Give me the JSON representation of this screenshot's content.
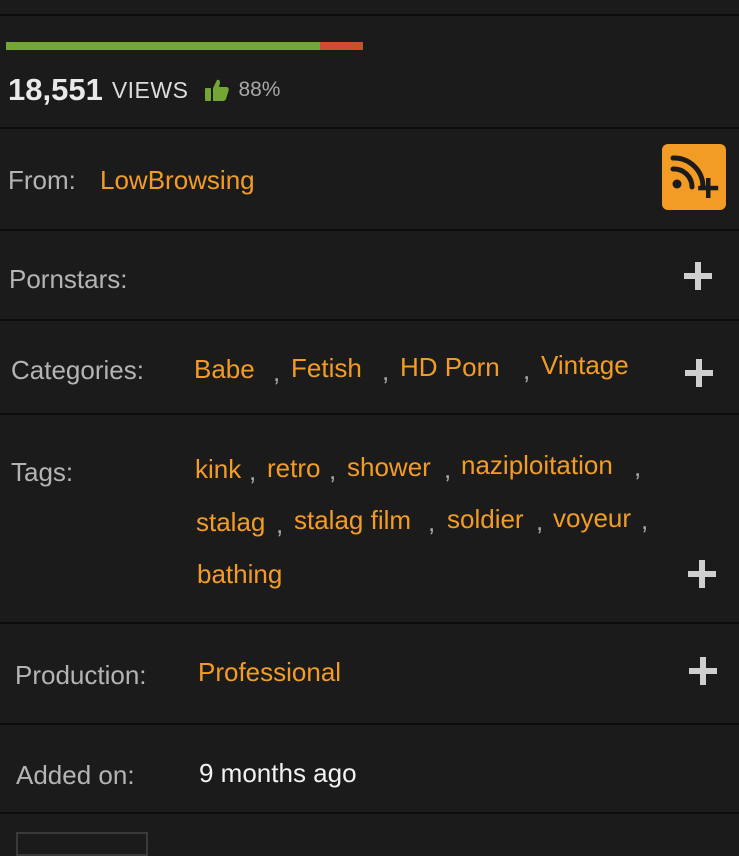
{
  "stats": {
    "views_count": "18,551",
    "views_label": "VIEWS",
    "rating_percent_label": "88%",
    "rating_fraction": 0.88,
    "like_color": "#74a633",
    "dislike_color": "#cc4e2a",
    "thumb_icon": "thumbs-up-icon"
  },
  "from": {
    "label": "From:",
    "value": "LowBrowsing",
    "subscribe_icon": "rss-plus-icon"
  },
  "pornstars": {
    "label": "Pornstars:",
    "add_icon": "plus-icon"
  },
  "categories": {
    "label": "Categories:",
    "items": [
      "Babe",
      "Fetish",
      "HD Porn",
      "Vintage"
    ],
    "separator": ",",
    "add_icon": "plus-icon"
  },
  "tags": {
    "label": "Tags:",
    "items": [
      "kink",
      "retro",
      "shower",
      "naziploitation",
      "stalag",
      "stalag film",
      "soldier",
      "voyeur",
      "bathing"
    ],
    "separator": ",",
    "add_icon": "plus-icon"
  },
  "production": {
    "label": "Production:",
    "value": "Professional",
    "add_icon": "plus-icon"
  },
  "added_on": {
    "label": "Added on:",
    "value": "9 months ago"
  },
  "colors": {
    "accent": "#f39c25",
    "background": "#1b1b1b",
    "divider": "#0c0c0c",
    "label_text": "#b4b4b4"
  }
}
